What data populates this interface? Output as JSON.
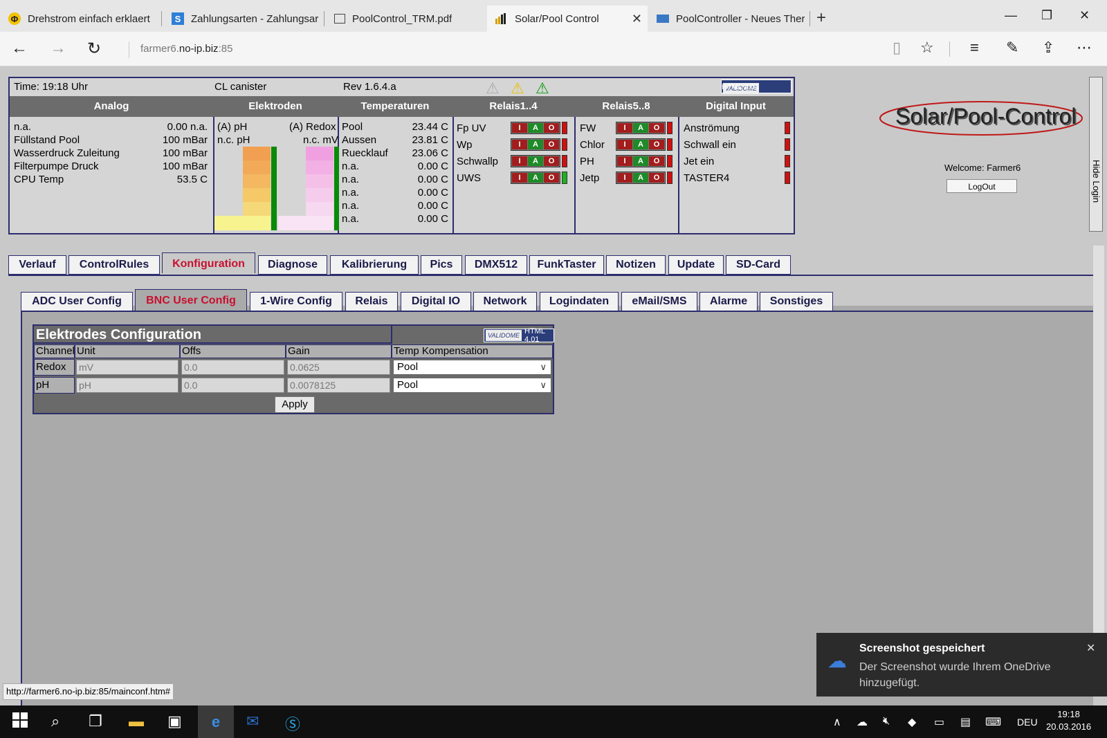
{
  "browser": {
    "tabs": [
      {
        "title": "Drehstrom einfach erklaert",
        "icon": "phi-icon"
      },
      {
        "title": "Zahlungsarten - Zahlungsar",
        "icon": "s-icon"
      },
      {
        "title": "PoolControl_TRM.pdf",
        "icon": "pdf-icon"
      },
      {
        "title": "Solar/Pool Control",
        "icon": "bars-icon"
      },
      {
        "title": "PoolController - Neues Ther",
        "icon": "site-icon"
      }
    ],
    "url_prefix": "farmer6.",
    "url_host": "no-ip.biz",
    "url_port": ":85"
  },
  "status": {
    "time": "Time: 19:18 Uhr",
    "mode": "CL canister",
    "rev": "Rev 1.6.4.a",
    "badge_left": "VALIDOME",
    "badge_right": "HTML 4.01"
  },
  "headers": {
    "analog": "Analog",
    "elektroden": "Elektroden",
    "temperaturen": "Temperaturen",
    "relais14": "Relais1..4",
    "relais58": "Relais5..8",
    "digital": "Digital Input"
  },
  "analog": [
    {
      "label": "n.a.",
      "value": "0.00 n.a."
    },
    {
      "label": "Füllstand Pool",
      "value": "100 mBar"
    },
    {
      "label": "Wasserdruck Zuleitung",
      "value": "100 mBar"
    },
    {
      "label": "Filterpumpe Druck",
      "value": "100 mBar"
    },
    {
      "label": "CPU Temp",
      "value": "53.5 C"
    }
  ],
  "elektroden": {
    "ph_label": "(A) pH",
    "redox_label": "(A) Redox",
    "ph_value": "n.c. pH",
    "redox_value": "n.c. mV"
  },
  "temperaturen": [
    {
      "label": "Pool",
      "value": "23.44 C"
    },
    {
      "label": "Aussen",
      "value": "23.81 C"
    },
    {
      "label": "Ruecklauf",
      "value": "23.06 C"
    },
    {
      "label": "n.a.",
      "value": "0.00 C"
    },
    {
      "label": "n.a.",
      "value": "0.00 C"
    },
    {
      "label": "n.a.",
      "value": "0.00 C"
    },
    {
      "label": "n.a.",
      "value": "0.00 C"
    },
    {
      "label": "n.a.",
      "value": "0.00 C"
    }
  ],
  "relais14": [
    {
      "label": "Fp UV",
      "state": "red"
    },
    {
      "label": "Wp",
      "state": "red"
    },
    {
      "label": "Schwallp",
      "state": "red"
    },
    {
      "label": "UWS",
      "state": "green"
    }
  ],
  "relais58": [
    {
      "label": "FW",
      "state": "red"
    },
    {
      "label": "Chlor",
      "state": "red"
    },
    {
      "label": "PH",
      "state": "red"
    },
    {
      "label": "Jetp",
      "state": "red"
    }
  ],
  "iao": {
    "i": "I",
    "a": "A",
    "o": "O"
  },
  "digital": [
    {
      "label": "Anströmung",
      "state": "red"
    },
    {
      "label": "Schwall ein",
      "state": "red"
    },
    {
      "label": "Jet ein",
      "state": "red"
    },
    {
      "label": "TASTER4",
      "state": "red"
    }
  ],
  "login": {
    "logo": "Solar/Pool-Control",
    "welcome": "Welcome:  Farmer6",
    "logout": "LogOut",
    "hide": "Hide Login"
  },
  "main_tabs": [
    "Verlauf",
    "ControlRules",
    "Konfiguration",
    "Diagnose",
    "Kalibrierung",
    "Pics",
    "DMX512",
    "FunkTaster",
    "Notizen",
    "Update",
    "SD-Card"
  ],
  "main_active": "Konfiguration",
  "sub_tabs": [
    "ADC User Config",
    "BNC User Config",
    "1-Wire Config",
    "Relais",
    "Digital IO",
    "Network",
    "Logindaten",
    "eMail/SMS",
    "Alarme",
    "Sonstiges"
  ],
  "sub_active": "BNC User Config",
  "config": {
    "title": "Elektrodes Configuration",
    "columns": [
      "Channel",
      "Unit",
      "Offs",
      "Gain",
      "Temp Kompensation"
    ],
    "rows": [
      {
        "channel": "Redox",
        "unit": "mV",
        "offs": "0.0",
        "gain": "0.0625",
        "temp": "Pool"
      },
      {
        "channel": "pH",
        "unit": "pH",
        "offs": "0.0",
        "gain": "0.0078125",
        "temp": "Pool"
      }
    ],
    "apply": "Apply"
  },
  "status_url": "http://farmer6.no-ip.biz:85/mainconf.htm#",
  "toast": {
    "title": "Screenshot gespeichert",
    "body": "Der Screenshot wurde Ihrem OneDrive hinzugefügt."
  },
  "taskbar": {
    "lang": "DEU",
    "time": "19:18",
    "date": "20.03.2016"
  },
  "colors": {
    "accent_red": "#c8102e",
    "frame_blue": "#2c2c6e",
    "led_red": "#d01010",
    "led_green": "#20b020"
  }
}
